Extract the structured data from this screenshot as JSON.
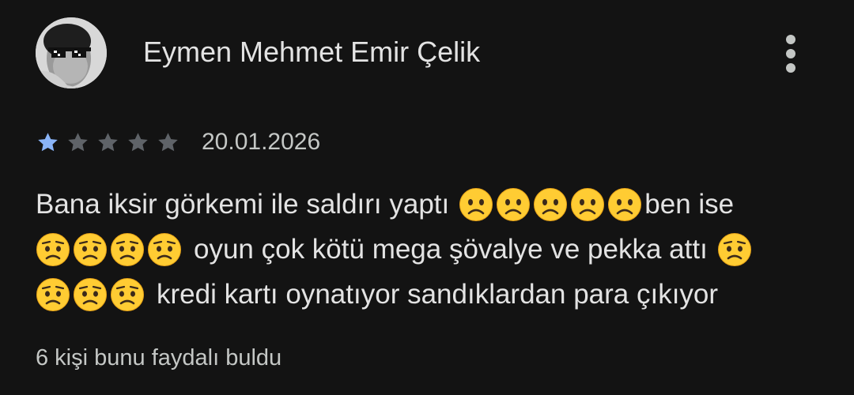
{
  "review": {
    "author_name": "Eymen Mehmet Emir Çelik",
    "avatar_icon": "avatar-sunglasses-photo",
    "more_options_icon": "more-vert-icon",
    "rating": 1,
    "rating_max": 5,
    "star_filled_color": "#8ab4f8",
    "star_empty_color": "#5f6368",
    "date": "20.01.2026",
    "body_segments": {
      "line1_text": "Bana iksir görkemi ile saldırı yaptı",
      "line1_emoji": "frowning-face",
      "line1_emoji_count": 5,
      "line1_tail": "ben ise",
      "line2_emoji": "worried-face",
      "line2_emoji_count": 4,
      "line2_text": "oyun çok kötü mega şövalye ve pekka attı",
      "line2_tail_emoji": "worried-face",
      "line3_emoji": "worried-face",
      "line3_emoji_count": 3,
      "line3_text": "kredi kartı oynatıyor sandıklardan para çıkıyor"
    },
    "helpful_text": "6 kişi bunu faydalı buldu"
  }
}
